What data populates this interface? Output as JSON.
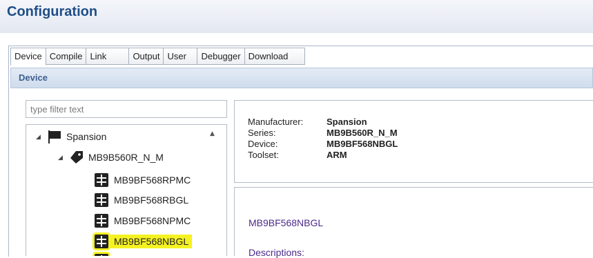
{
  "page": {
    "title": "Configuration"
  },
  "tabs": [
    {
      "label": "Device",
      "active": true
    },
    {
      "label": "Compile"
    },
    {
      "label": "Link"
    },
    {
      "label": "Output"
    },
    {
      "label": "User"
    },
    {
      "label": "Debugger"
    },
    {
      "label": "Download"
    }
  ],
  "section": {
    "title": "Device"
  },
  "filter": {
    "placeholder": "type filter text",
    "value": ""
  },
  "tree": {
    "manufacturer": "Spansion",
    "series": "MB9B560R_N_M",
    "devices": [
      "MB9BF568RPMC",
      "MB9BF568RBGL",
      "MB9BF568NPMC",
      "MB9BF568NBGL"
    ],
    "selected": "MB9BF568NBGL"
  },
  "info": {
    "manufacturer_label": "Manufacturer:",
    "manufacturer_value": "Spansion",
    "series_label": "Series:",
    "series_value": "MB9B560R_N_M",
    "device_label": "Device:",
    "device_value": "MB9BF568NBGL",
    "toolset_label": "Toolset:",
    "toolset_value": "ARM"
  },
  "description": {
    "device_name": "MB9BF568NBGL",
    "label": "Descriptions:"
  },
  "colors": {
    "title": "#1f4e87",
    "highlight": "#f5f223",
    "link": "#4b2a8a"
  }
}
